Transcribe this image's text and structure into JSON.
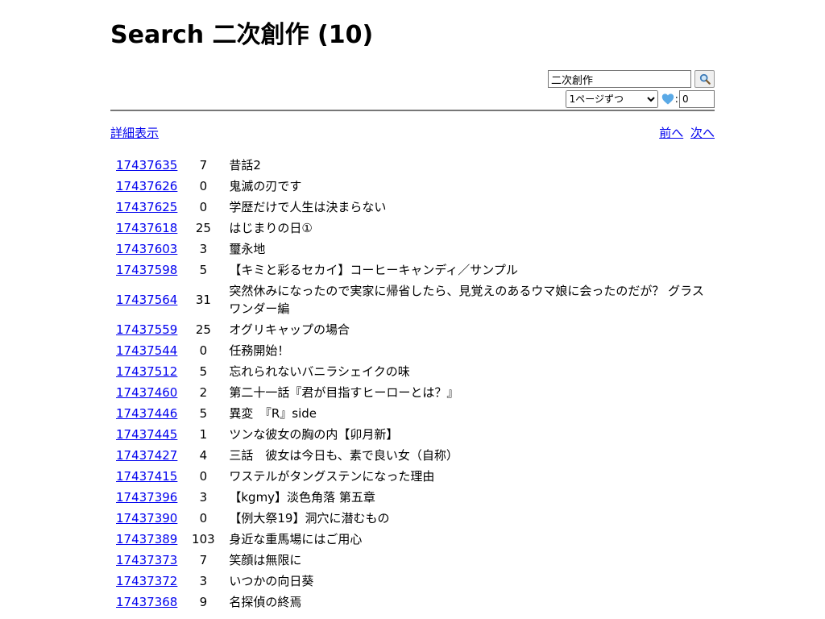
{
  "page": {
    "title": "Search 二次創作 (10)"
  },
  "search": {
    "value": "二次創作",
    "button_icon": "magnifier-icon"
  },
  "options": {
    "per_page_selected": "1ページずつ",
    "heart_icon": "heart-icon",
    "heart_color": "#5aa9e6",
    "colon": ":",
    "count_value": "0"
  },
  "nav": {
    "detail_label": "詳細表示",
    "prev_label": "前へ",
    "next_label": "次へ"
  },
  "results": [
    {
      "id": "17437635",
      "count": "7",
      "title": "昔話2"
    },
    {
      "id": "17437626",
      "count": "0",
      "title": "鬼滅の刃です"
    },
    {
      "id": "17437625",
      "count": "0",
      "title": "学歴だけで人生は決まらない"
    },
    {
      "id": "17437618",
      "count": "25",
      "title": "はじまりの日①"
    },
    {
      "id": "17437603",
      "count": "3",
      "title": "璽永地"
    },
    {
      "id": "17437598",
      "count": "5",
      "title": "【キミと彩るセカイ】コーヒーキャンディ／サンプル"
    },
    {
      "id": "17437564",
      "count": "31",
      "title": "突然休みになったので実家に帰省したら、見覚えのあるウマ娘に会ったのだが？ グラスワンダー編"
    },
    {
      "id": "17437559",
      "count": "25",
      "title": "オグリキャップの場合"
    },
    {
      "id": "17437544",
      "count": "0",
      "title": "任務開始！"
    },
    {
      "id": "17437512",
      "count": "5",
      "title": "忘れられないバニラシェイクの味"
    },
    {
      "id": "17437460",
      "count": "2",
      "title": "第二十一話『君が目指すヒーローとは？』"
    },
    {
      "id": "17437446",
      "count": "5",
      "title": "異変　『R』side"
    },
    {
      "id": "17437445",
      "count": "1",
      "title": "ツンな彼女の胸の内【卯月新】"
    },
    {
      "id": "17437427",
      "count": "4",
      "title": "三話　彼女は今日も、素で良い女（自称）"
    },
    {
      "id": "17437415",
      "count": "0",
      "title": "ワステルがタングステンになった理由"
    },
    {
      "id": "17437396",
      "count": "3",
      "title": "【kgmy】淡色角落 第五章"
    },
    {
      "id": "17437390",
      "count": "0",
      "title": "【例大祭19】洞穴に潜むもの"
    },
    {
      "id": "17437389",
      "count": "103",
      "title": "身近な重馬場にはご用心"
    },
    {
      "id": "17437373",
      "count": "7",
      "title": "笑顔は無限に"
    },
    {
      "id": "17437372",
      "count": "3",
      "title": "いつかの向日葵"
    },
    {
      "id": "17437368",
      "count": "9",
      "title": "名探偵の終焉"
    }
  ]
}
